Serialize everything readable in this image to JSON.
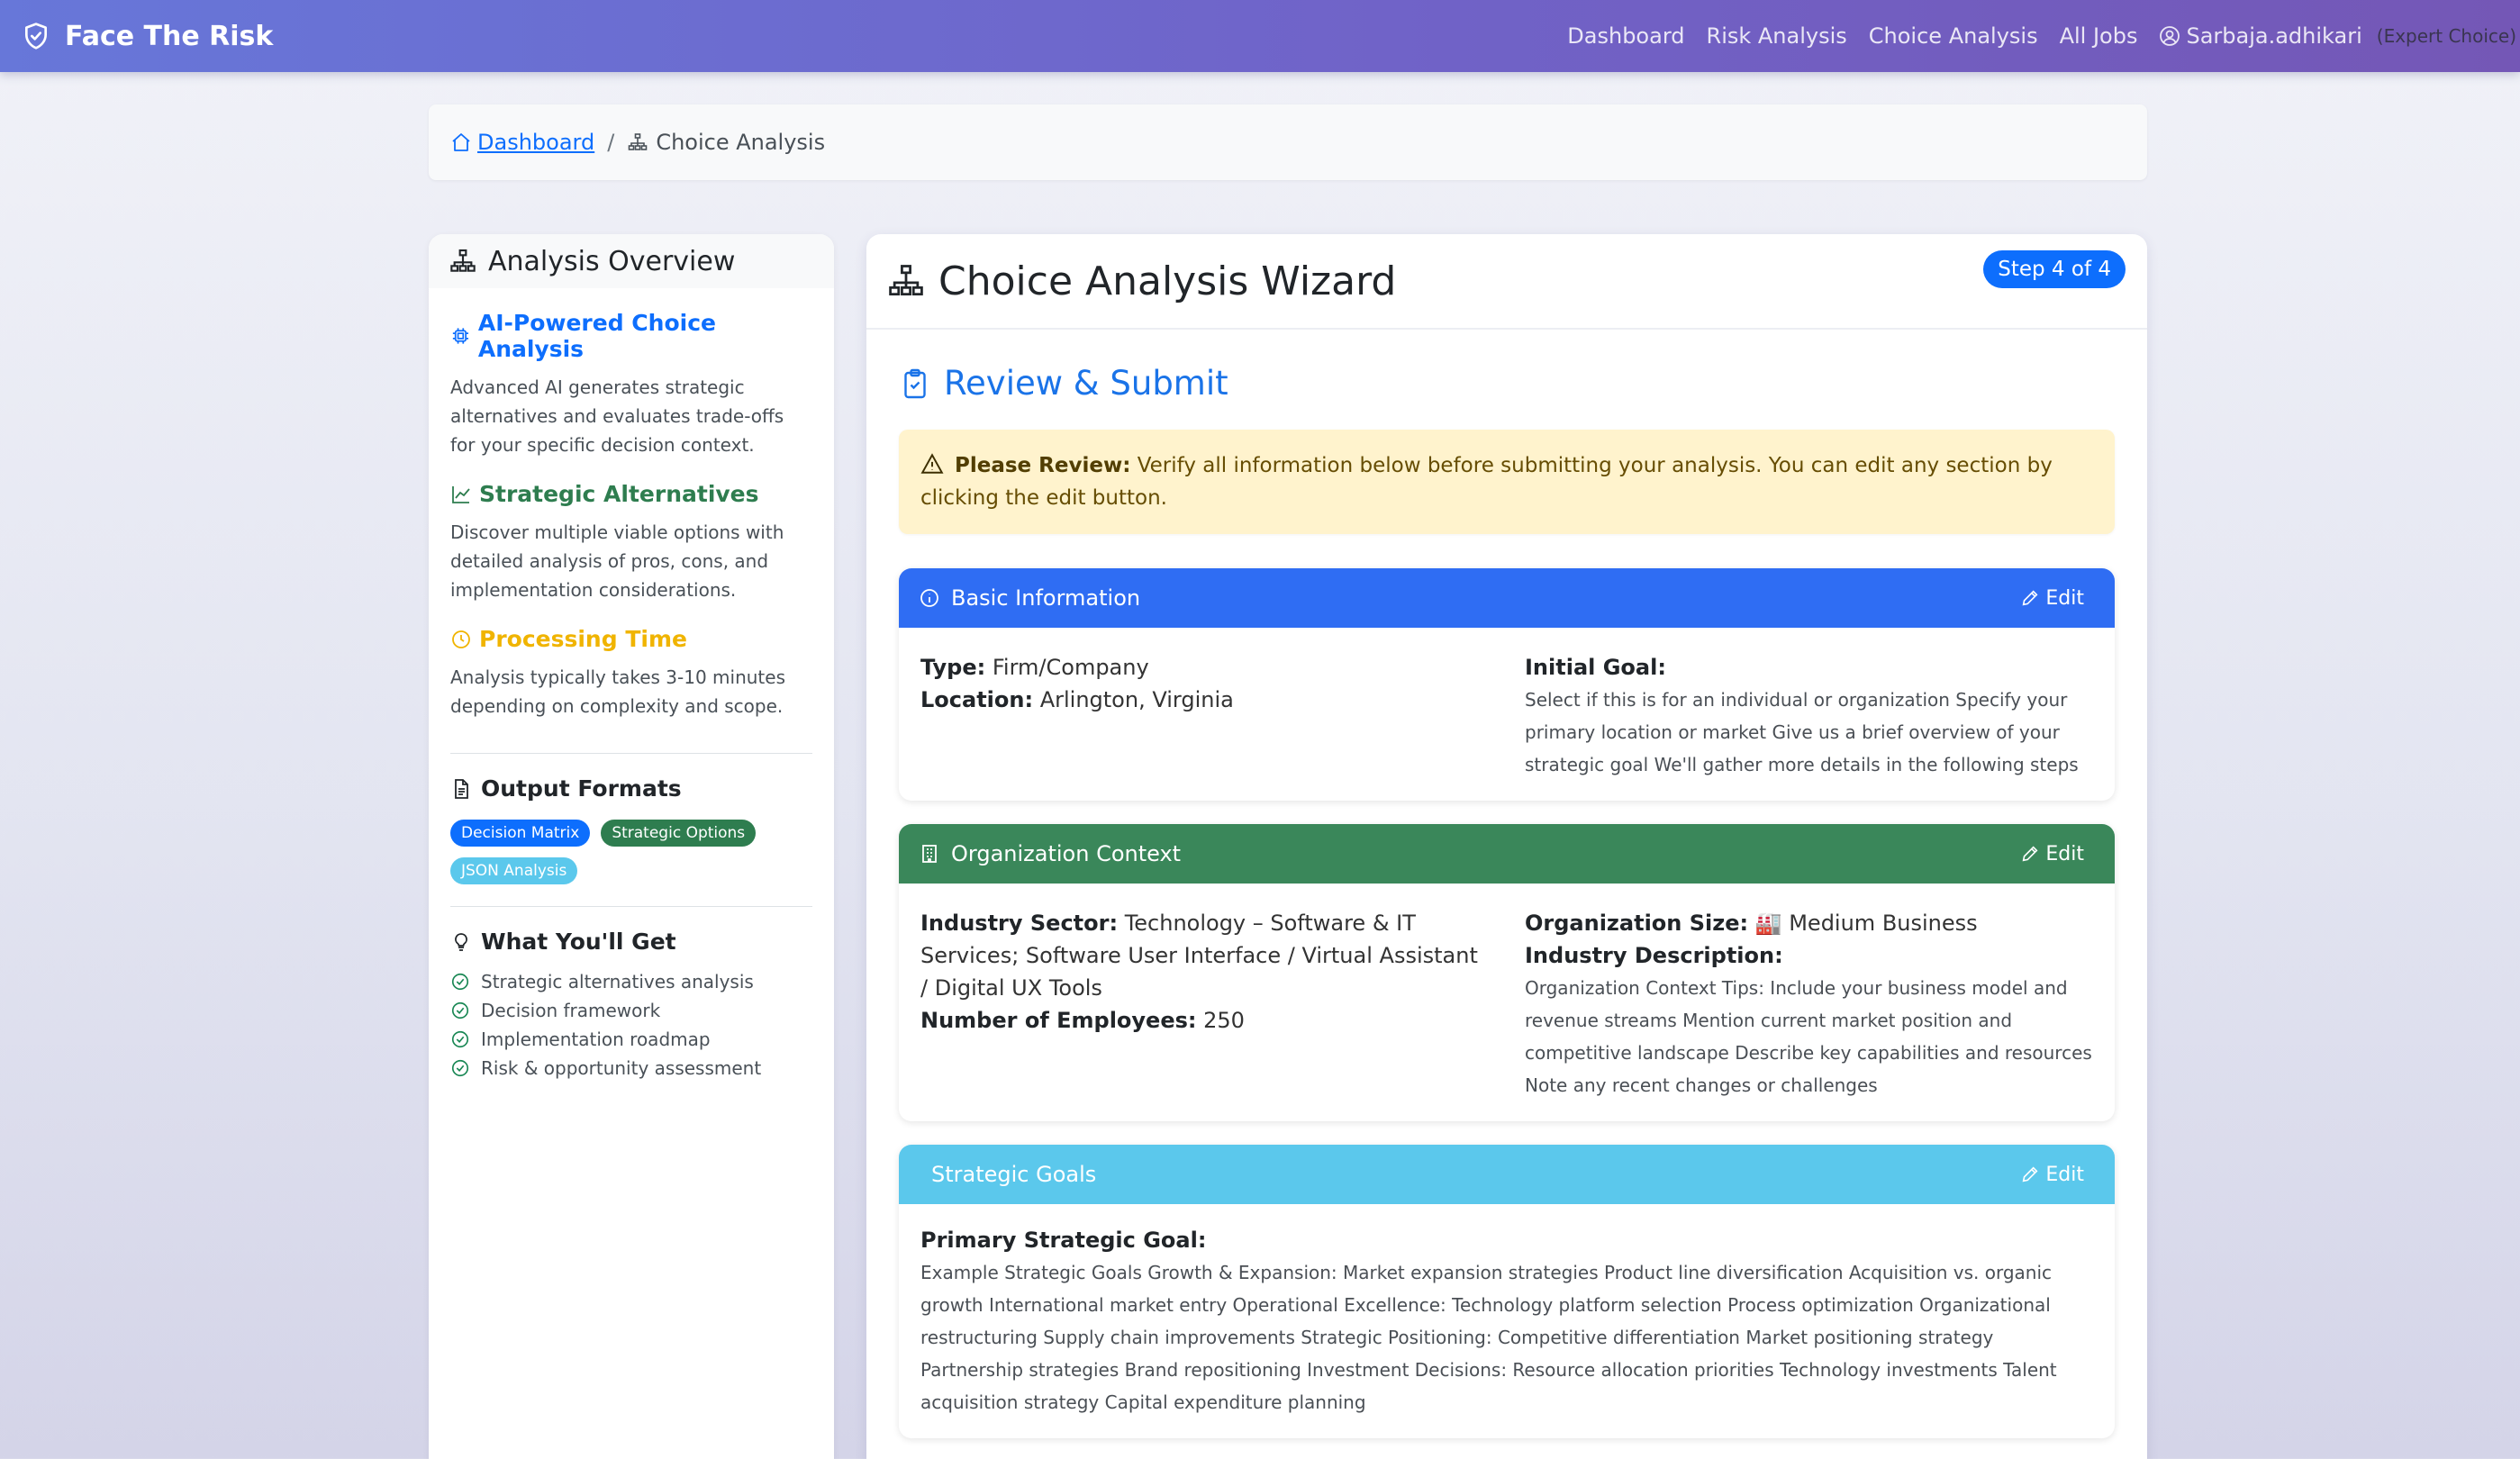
{
  "navbar": {
    "brand": "Face The Risk",
    "links": [
      "Dashboard",
      "Risk Analysis",
      "Choice Analysis",
      "All Jobs"
    ],
    "username": "Sarbaja.adhikari",
    "role": "(Expert Choice)"
  },
  "breadcrumb": {
    "home": "Dashboard",
    "separator": "/",
    "current": "Choice Analysis"
  },
  "sidebar": {
    "title": "Analysis Overview",
    "features": [
      {
        "title": "AI-Powered Choice Analysis",
        "text": "Advanced AI generates strategic alternatives and evaluates trade-offs for your specific decision context."
      },
      {
        "title": "Strategic Alternatives",
        "text": "Discover multiple viable options with detailed analysis of pros, cons, and implementation considerations."
      },
      {
        "title": "Processing Time",
        "text": "Analysis typically takes 3-10 minutes depending on complexity and scope."
      }
    ],
    "output_formats_title": "Output Formats",
    "output_formats": [
      "Decision Matrix",
      "Strategic Options",
      "JSON Analysis"
    ],
    "get_title": "What You'll Get",
    "get_items": [
      "Strategic alternatives analysis",
      "Decision framework",
      "Implementation roadmap",
      "Risk & opportunity assessment"
    ]
  },
  "wizard": {
    "title": "Choice Analysis Wizard",
    "step": "Step 4 of 4",
    "review_title": "Review & Submit",
    "alert_strong": "Please Review:",
    "alert_text": " Verify all information below before submitting your analysis. You can edit any section by clicking the edit button.",
    "edit_label": "Edit",
    "basic": {
      "title": "Basic Information",
      "type_label": "Type:",
      "type_value": " Firm/Company",
      "location_label": "Location:",
      "location_value": " Arlington, Virginia",
      "goal_label": "Initial Goal:",
      "goal_value": "Select if this is for an individual or organization Specify your primary location or market Give us a brief overview of your strategic goal We'll gather more details in the following steps"
    },
    "org": {
      "title": "Organization Context",
      "sector_label": "Industry Sector:",
      "sector_value": " Technology – Software & IT Services; Software User Interface / Virtual Assistant / Digital UX Tools",
      "employees_label": "Number of Employees:",
      "employees_value": " 250",
      "size_label": "Organization Size:",
      "size_value": " 🏭 Medium Business",
      "desc_label": "Industry Description:",
      "desc_value": "Organization Context Tips: Include your business model and revenue streams Mention current market position and competitive landscape Describe key capabilities and resources Note any recent changes or challenges"
    },
    "goals": {
      "title": "Strategic Goals",
      "primary_label": "Primary Strategic Goal:",
      "primary_value": "Example Strategic Goals Growth & Expansion: Market expansion strategies Product line diversification Acquisition vs. organic growth International market entry Operational Excellence: Technology platform selection Process optimization Organizational restructuring Supply chain improvements Strategic Positioning: Competitive differentiation Market positioning strategy Partnership strategies Brand repositioning Investment Decisions: Resource allocation priorities Technology investments Talent acquisition strategy Capital expenditure planning"
    }
  },
  "colors": {
    "navbar_start": "#6777d9",
    "navbar_end": "#7457b6",
    "primary": "#0d6efd",
    "success": "#3a875a",
    "info": "#5bc8ec",
    "warning_bg": "#fff3cd"
  }
}
